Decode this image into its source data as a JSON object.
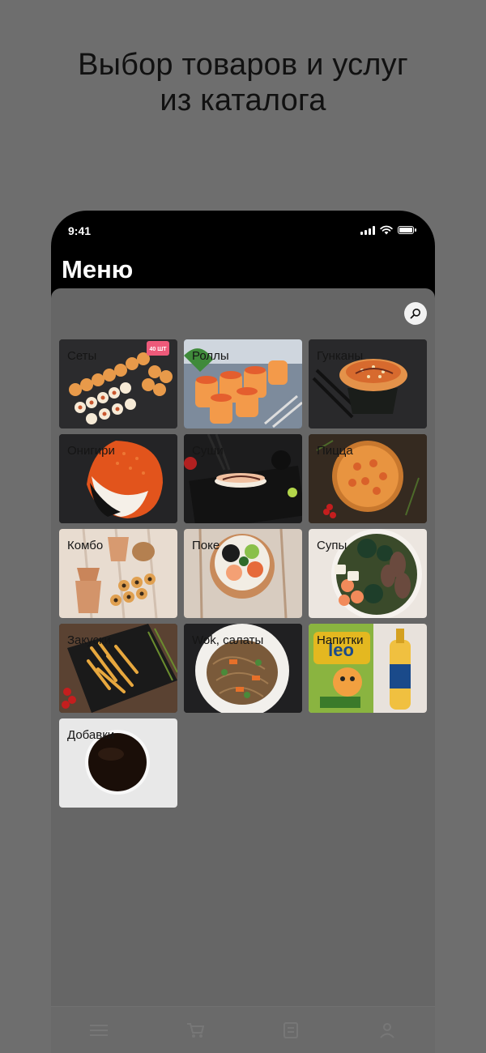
{
  "promo": {
    "title_line1": "Выбор товаров и услуг",
    "title_line2": "из каталога"
  },
  "status_bar": {
    "time": "9:41"
  },
  "nav": {
    "title": "Меню"
  },
  "search": {
    "icon": "search-icon"
  },
  "categories": [
    {
      "label": "Сеты",
      "icon": "sushi-set"
    },
    {
      "label": "Роллы",
      "icon": "rolls"
    },
    {
      "label": "Гунканы",
      "icon": "gunkan"
    },
    {
      "label": "Онигири",
      "icon": "onigiri"
    },
    {
      "label": "Суши",
      "icon": "sushi"
    },
    {
      "label": "Пицца",
      "icon": "pizza"
    },
    {
      "label": "Комбо",
      "icon": "combo-boxes"
    },
    {
      "label": "Поке",
      "icon": "poke-bowl"
    },
    {
      "label": "Супы",
      "icon": "soup-bowl"
    },
    {
      "label": "Закуски",
      "icon": "fries"
    },
    {
      "label": "Wok, салаты",
      "icon": "wok-noodles"
    },
    {
      "label": "Напитки",
      "icon": "drinks"
    },
    {
      "label": "Добавки",
      "icon": "sauce"
    }
  ],
  "tab_bar": {
    "items": [
      "menu-icon",
      "cart-icon",
      "orders-icon",
      "profile-icon"
    ]
  },
  "colors": {
    "overlay_gray": "#6e6e6e",
    "phone_black": "#000000",
    "title_text": "#111111"
  }
}
